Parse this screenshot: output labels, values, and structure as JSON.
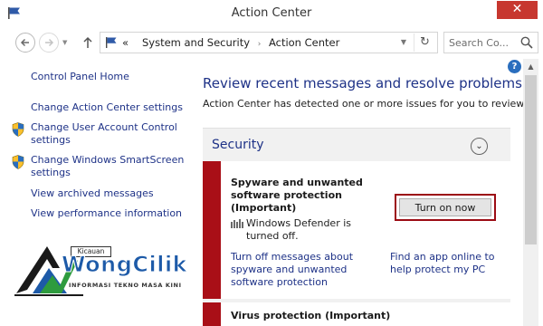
{
  "window": {
    "title": "Action Center",
    "close_glyph": "✕"
  },
  "address_bar": {
    "overflow": "«",
    "crumbs": [
      "System and Security",
      "Action Center"
    ],
    "separator": "›",
    "search_placeholder": "Search Co...",
    "icons": [
      "back-icon",
      "forward-icon",
      "recent-locations-icon",
      "up-icon",
      "flag-icon",
      "refresh-icon",
      "search-icon"
    ]
  },
  "sidebar": {
    "home": "Control Panel Home",
    "items": [
      {
        "label": "Change Action Center settings",
        "shield": false
      },
      {
        "label": "Change User Account Control settings",
        "shield": true
      },
      {
        "label": "Change Windows SmartScreen settings",
        "shield": true
      },
      {
        "label": "View archived messages",
        "shield": false
      },
      {
        "label": "View performance information",
        "shield": false
      }
    ]
  },
  "main": {
    "heading": "Review recent messages and resolve problems",
    "description": "Action Center has detected one or more issues for you to review.",
    "section": {
      "title": "Security",
      "alerts": [
        {
          "title": "Spyware and unwanted software protection (Important)",
          "status": "Windows Defender is turned off.",
          "button": "Turn on now",
          "link_left": "Turn off messages about spyware and unwanted software protection",
          "link_right": "Find an app online to help protect my PC"
        },
        {
          "title": "Virus protection (Important)"
        }
      ]
    }
  },
  "help": {
    "glyph": "?"
  },
  "watermark": {
    "small": "Kicauan",
    "big": "WongCilik",
    "tagline": "INFORMASI TEKNO MASA KINI"
  },
  "colors": {
    "link": "#1e3287",
    "alert_bar": "#a90f17",
    "highlight_border": "#9c0c14",
    "close_button": "#c7372f"
  }
}
